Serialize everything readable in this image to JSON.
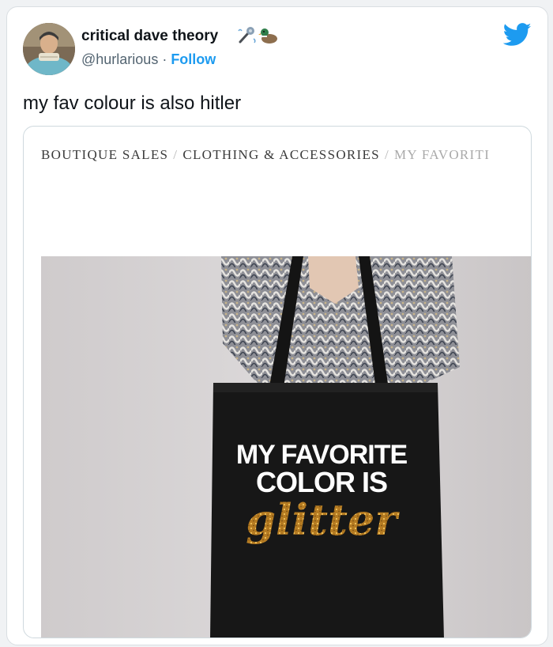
{
  "tweet": {
    "author_name": "critical dave theory",
    "name_emojis": [
      "microphone-emoji",
      "duck-emoji"
    ],
    "handle": "@hurlarious",
    "separator": " · ",
    "follow_label": "Follow",
    "text": "my fav colour is also hitler",
    "brand_icon": "twitter-bird-icon"
  },
  "embed": {
    "breadcrumb": [
      {
        "label": "BOUTIQUE SALES"
      },
      {
        "label": "CLOTHING & ACCESSORIES"
      },
      {
        "label": "MY FAVORITI"
      }
    ],
    "separator": "/",
    "bag_print": {
      "line1": "MY FAVORITE",
      "line2": "COLOR IS",
      "line3": "glitter"
    }
  },
  "colors": {
    "link_blue": "#1d9bf0",
    "text_primary": "#0f1419",
    "text_secondary": "#536471",
    "glitter_gold": "#c58a2a"
  }
}
